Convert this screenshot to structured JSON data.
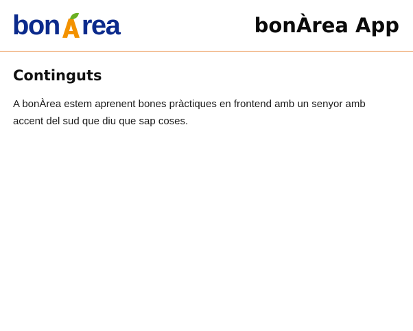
{
  "header": {
    "logo": {
      "text_before": "bon",
      "text_after": "rea",
      "brand_blue": "#0b2a8c",
      "brand_orange": "#f39200",
      "brand_green": "#6ab023"
    },
    "app_title": "bonÀrea App",
    "divider_color": "#e8883a"
  },
  "main": {
    "title": "Continguts",
    "paragraph": "A bonÀrea estem aprenent bones pràctiques en frontend amb un senyor amb accent del sud que diu que sap coses."
  }
}
